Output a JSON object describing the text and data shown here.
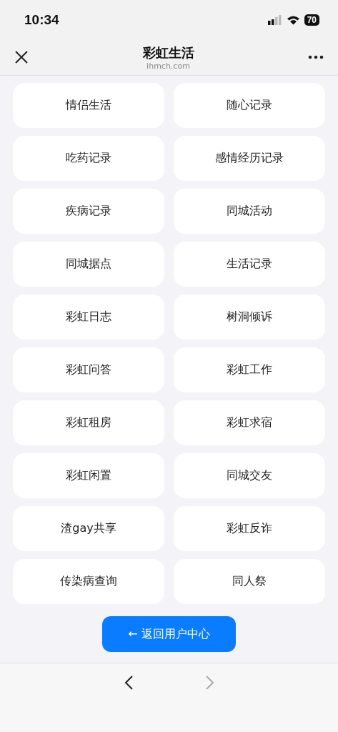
{
  "status_bar": {
    "time": "10:34",
    "battery": "70"
  },
  "header": {
    "title": "彩虹生活",
    "subtitle": "ihmch.com"
  },
  "items": [
    {
      "label": "情侣生活"
    },
    {
      "label": "随心记录"
    },
    {
      "label": "吃药记录"
    },
    {
      "label": "感情经历记录"
    },
    {
      "label": "疾病记录"
    },
    {
      "label": "同城活动"
    },
    {
      "label": "同城据点"
    },
    {
      "label": "生活记录"
    },
    {
      "label": "彩虹日志"
    },
    {
      "label": "树洞倾诉"
    },
    {
      "label": "彩虹问答"
    },
    {
      "label": "彩虹工作"
    },
    {
      "label": "彩虹租房"
    },
    {
      "label": "彩虹求宿"
    },
    {
      "label": "彩虹闲置"
    },
    {
      "label": "同城交友"
    },
    {
      "label": "渣gay共享"
    },
    {
      "label": "彩虹反诈"
    },
    {
      "label": "传染病查询"
    },
    {
      "label": "同人祭"
    }
  ],
  "back_button": {
    "label": "← 返回用户中心"
  },
  "browser_nav": {
    "back_disabled": false,
    "forward_disabled": true
  }
}
